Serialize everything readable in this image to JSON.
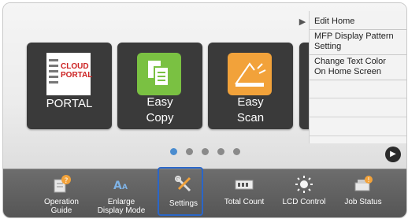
{
  "tiles": [
    {
      "label": "CLOUD PORTAL",
      "icon": "cloud-portal-icon"
    },
    {
      "label_line1": "Easy",
      "label_line2": "Copy",
      "icon": "easy-copy-icon"
    },
    {
      "label_line1": "Easy",
      "label_line2": "Scan",
      "icon": "easy-scan-icon"
    }
  ],
  "cloud_icon_text": {
    "line1": "CLOUD",
    "line2": "PORTAL"
  },
  "menu": {
    "items": [
      {
        "label": "Edit Home"
      },
      {
        "label_line1": "MFP Display Pattern",
        "label_line2": "Setting"
      },
      {
        "label_line1": "Change Text Color",
        "label_line2": "On Home Screen"
      }
    ]
  },
  "pagination": {
    "pages": 5,
    "current": 1
  },
  "bottom_bar": {
    "items": [
      {
        "label_line1": "Operation",
        "label_line2": "Guide",
        "icon": "operation-guide-icon"
      },
      {
        "label_line1": "Enlarge",
        "label_line2": "Display Mode",
        "icon": "enlarge-display-icon"
      },
      {
        "label": "Settings",
        "icon": "settings-icon"
      },
      {
        "label": "Total Count",
        "icon": "total-count-icon"
      },
      {
        "label": "LCD Control",
        "icon": "lcd-control-icon"
      },
      {
        "label": "Job Status",
        "icon": "job-status-icon"
      }
    ]
  },
  "colors": {
    "accent_blue": "#2a66c8",
    "copy_green": "#7ac142",
    "scan_orange": "#f2a23a"
  }
}
